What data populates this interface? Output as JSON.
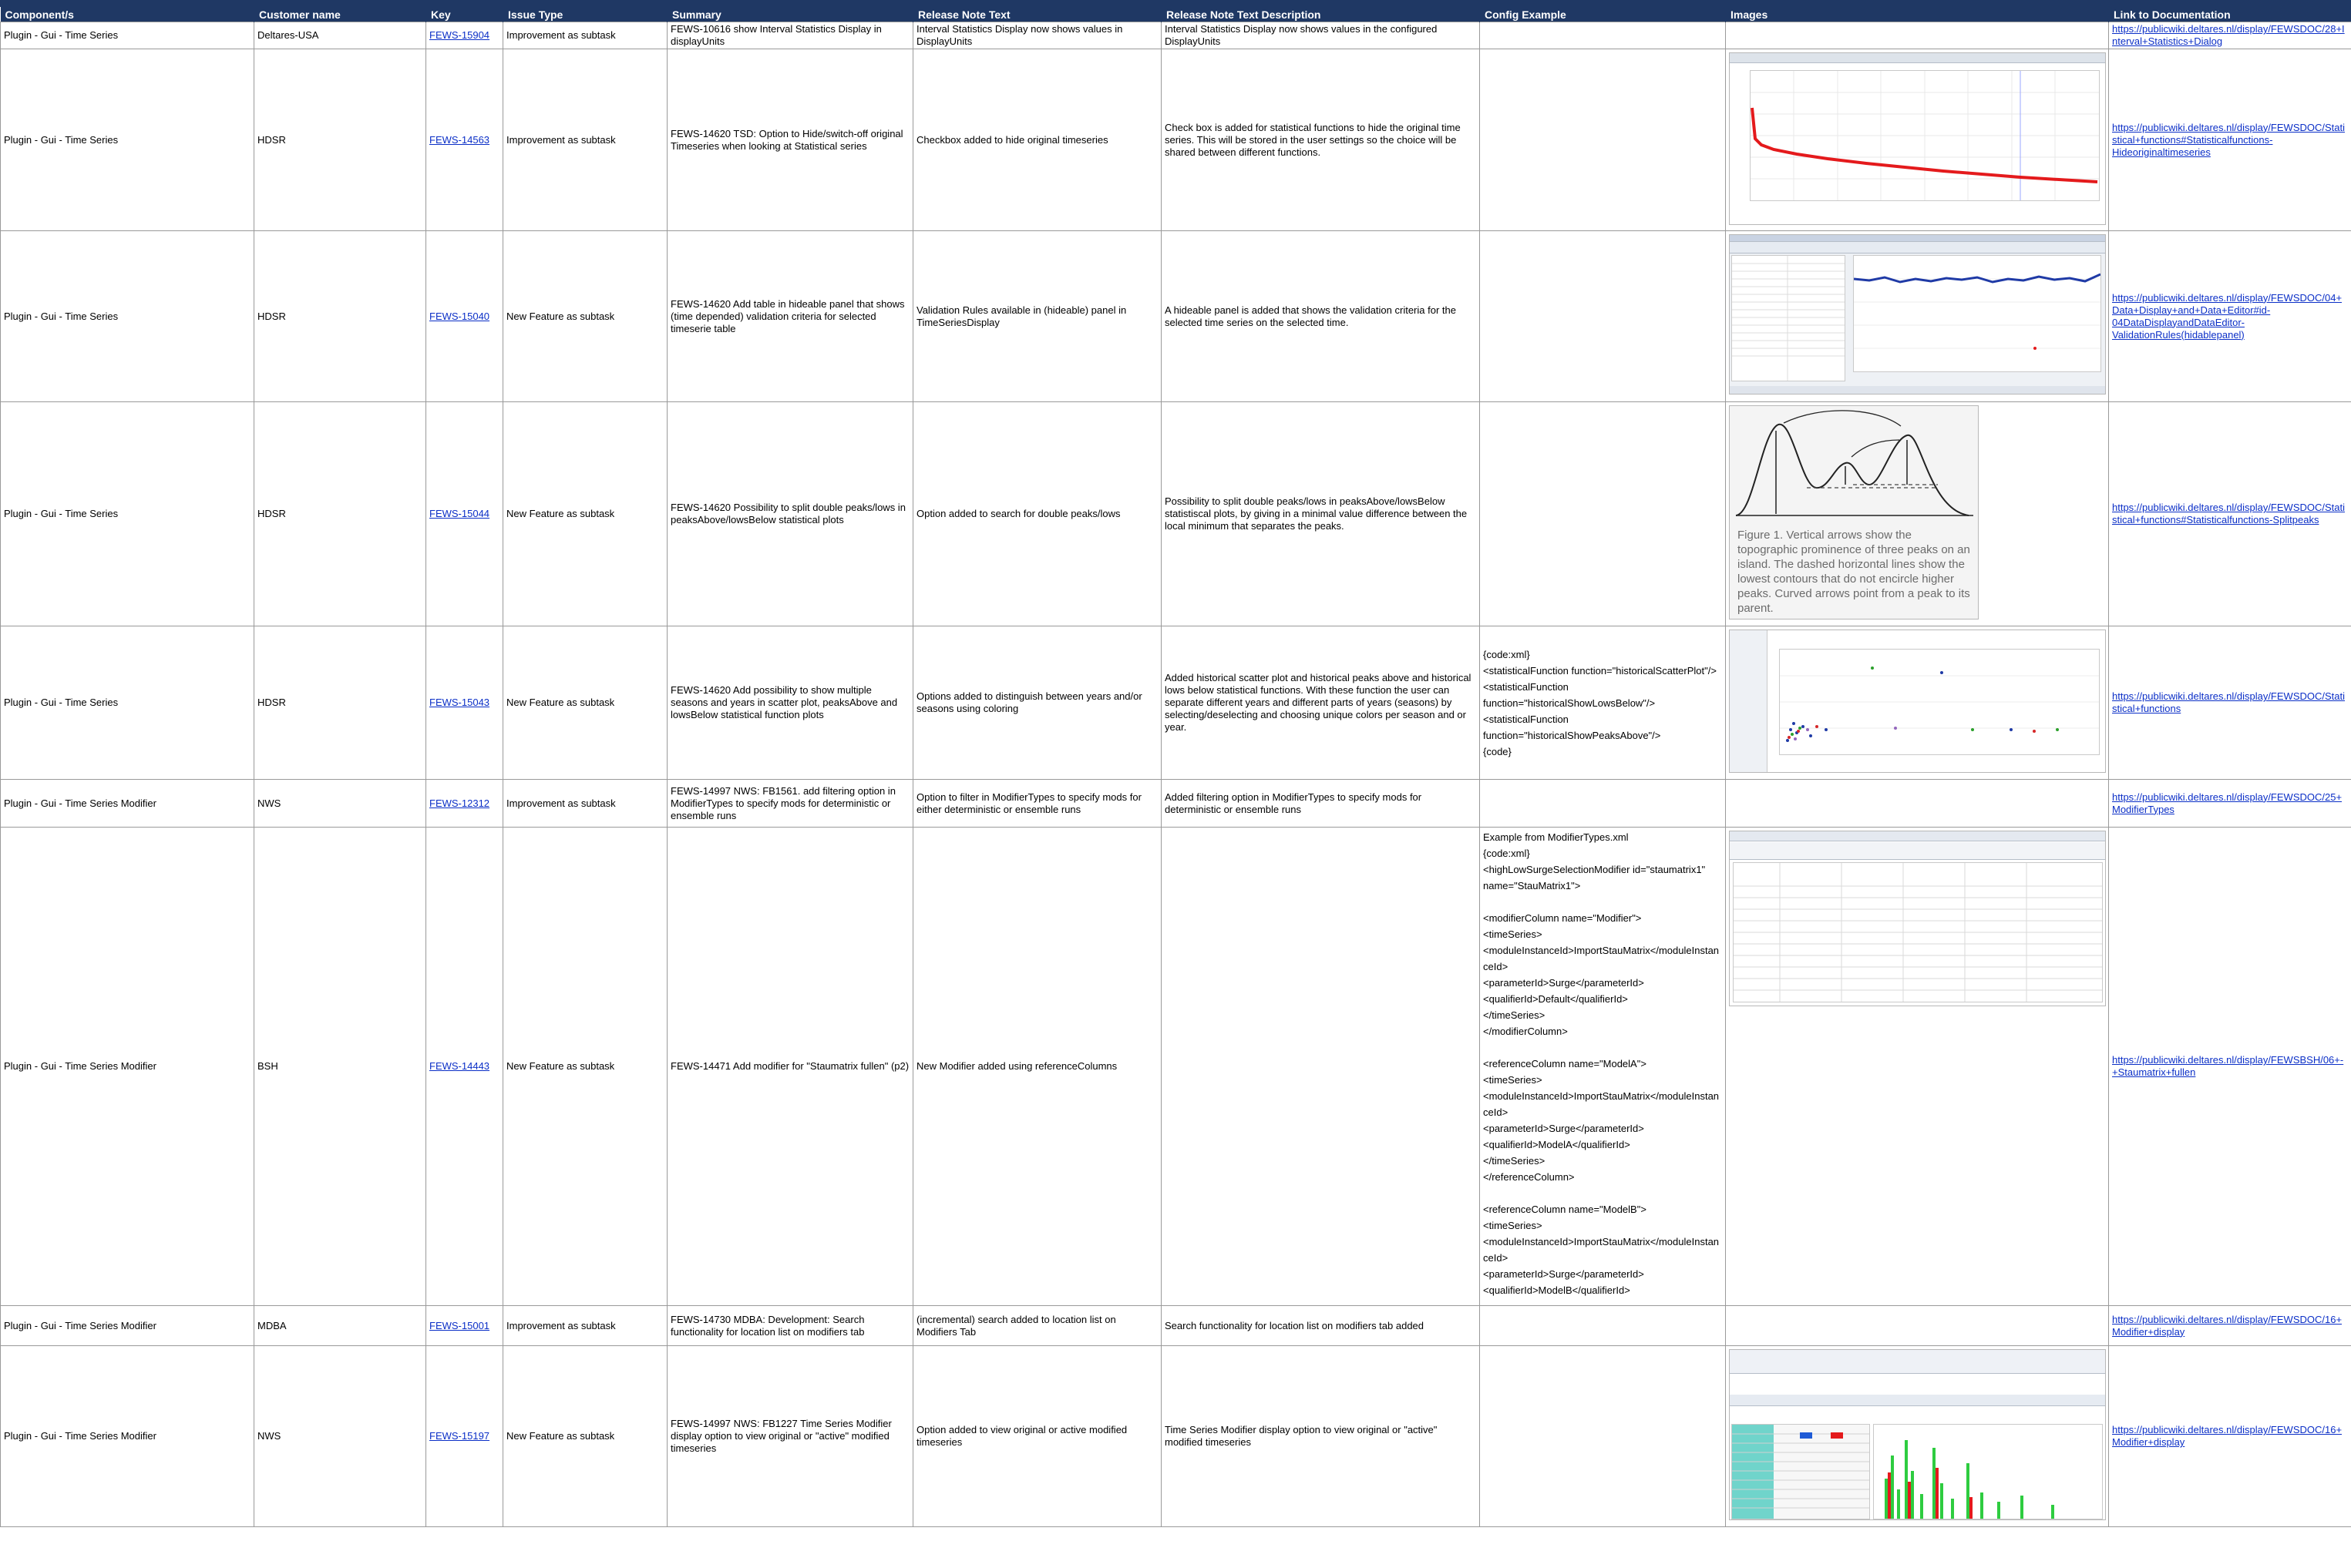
{
  "headers": {
    "component": "Component/s",
    "customer": "Customer name",
    "key": "Key",
    "issue_type": "Issue Type",
    "summary": "Summary",
    "release_note": "Release Note Text",
    "release_desc": "Release Note Text Description",
    "config": "Config Example",
    "images": "Images",
    "link": "Link to Documentation"
  },
  "rows": [
    {
      "component": "Plugin - Gui - Time Series",
      "customer": "Deltares-USA",
      "key": "FEWS-15904",
      "issue_type": "Improvement as subtask",
      "summary": "FEWS-10616 show Interval Statistics Display in displayUnits",
      "release_note": "Interval Statistics Display now shows values in DisplayUnits",
      "release_desc": "Interval Statistics Display now shows values in the configured DisplayUnits",
      "config": "",
      "link": "https://publicwiki.deltares.nl/display/FEWSDOC/28+Interval+Statistics+Dialog"
    },
    {
      "component": "Plugin - Gui - Time Series",
      "customer": "HDSR",
      "key": "FEWS-14563",
      "issue_type": "Improvement as subtask",
      "summary": "FEWS-14620 TSD: Option to Hide/switch-off original Timeseries when looking at Statistical series",
      "release_note": "Checkbox added to hide original timeseries",
      "release_desc": "Check box is added for statistical functions to hide the original time series. This will be stored in the user settings so the choice will be shared between different functions.",
      "config": "",
      "link": "https://publicwiki.deltares.nl/display/FEWSDOC/Statistical+functions#Statisticalfunctions-Hideoriginaltimeseries"
    },
    {
      "component": "Plugin - Gui - Time Series",
      "customer": "HDSR",
      "key": "FEWS-15040",
      "issue_type": "New Feature as subtask",
      "summary": "FEWS-14620 Add table in hideable panel that shows (time depended) validation criteria for selected timeserie table",
      "release_note": "Validation Rules available in (hideable) panel in TimeSeriesDisplay",
      "release_desc": "A hideable panel is added that shows the validation criteria for the selected time series on the selected time.",
      "config": "",
      "link": "https://publicwiki.deltares.nl/display/FEWSDOC/04+Data+Display+and+Data+Editor#id-04DataDisplayandDataEditor-ValidationRules(hidablepanel)"
    },
    {
      "component": "Plugin - Gui - Time Series",
      "customer": "HDSR",
      "key": "FEWS-15044",
      "issue_type": "New Feature as subtask",
      "summary": "FEWS-14620 Possibility to split double peaks/lows in peaksAbove/lowsBelow statistical plots",
      "release_note": "Option added to search for double peaks/lows",
      "release_desc": "Possibility to split double peaks/lows in peaksAbove/lowsBelow statistiscal plots, by giving in a minimal value difference between the local minimum that separates the peaks.",
      "config": "",
      "image_caption": "Figure 1. Vertical arrows show the topographic prominence of three peaks on an island. The dashed horizontal lines show the lowest contours that do not encircle higher peaks. Curved arrows point from a peak to its parent.",
      "link": "https://publicwiki.deltares.nl/display/FEWSDOC/Statistical+functions#Statisticalfunctions-Splitpeaks"
    },
    {
      "component": "Plugin - Gui - Time Series",
      "customer": "HDSR",
      "key": "FEWS-15043",
      "issue_type": "New Feature as subtask",
      "summary": "FEWS-14620 Add possibility to show multiple seasons and years in scatter plot, peaksAbove and lowsBelow statistical function plots",
      "release_note": "Options added to distinguish between years and/or seasons using coloring",
      "release_desc": "Added historical scatter plot and historical peaks above and historical lows below statistical functions. With these function the user can separate different years and different parts of years (seasons) by selecting/deselecting and choosing unique colors per season and or year.",
      "config": "{code:xml}\n<statisticalFunction function=\"historicalScatterPlot\"/>\n<statisticalFunction function=\"historicalShowLowsBelow\"/>\n<statisticalFunction function=\"historicalShowPeaksAbove\"/>\n{code}",
      "link": "https://publicwiki.deltares.nl/display/FEWSDOC/Statistical+functions"
    },
    {
      "component": "Plugin - Gui - Time Series Modifier",
      "customer": "NWS",
      "key": "FEWS-12312",
      "issue_type": "Improvement as subtask",
      "summary": "FEWS-14997 NWS: FB1561. add filtering option in ModifierTypes to specify mods for deterministic or ensemble runs",
      "release_note": "Option to filter in ModifierTypes to specify mods for either deterministic or ensemble runs",
      "release_desc": "Added filtering option in ModifierTypes to specify mods for deterministic or ensemble runs",
      "config": "",
      "link": "https://publicwiki.deltares.nl/display/FEWSDOC/25+ModifierTypes"
    },
    {
      "component": "Plugin - Gui - Time Series Modifier",
      "customer": "BSH",
      "key": "FEWS-14443",
      "issue_type": "New Feature as subtask",
      "summary": "FEWS-14471 Add modifier for \"Staumatrix fullen\" (p2)",
      "release_note": "New Modifier added using referenceColumns",
      "release_desc": "",
      "config": "Example from ModifierTypes.xml\n{code:xml}\n<highLowSurgeSelectionModifier id=\"staumatrix1\" name=\"StauMatrix1\">\n\n<modifierColumn name=\"Modifier\">\n<timeSeries>\n<moduleInstanceId>ImportStauMatrix</moduleInstanceId>\n<parameterId>Surge</parameterId>\n<qualifierId>Default</qualifierId>\n</timeSeries>\n</modifierColumn>\n\n<referenceColumn name=\"ModelA\">\n<timeSeries>\n<moduleInstanceId>ImportStauMatrix</moduleInstanceId>\n<parameterId>Surge</parameterId>\n<qualifierId>ModelA</qualifierId>\n</timeSeries>\n</referenceColumn>\n\n<referenceColumn name=\"ModelB\">\n<timeSeries>\n<moduleInstanceId>ImportStauMatrix</moduleInstanceId>\n<parameterId>Surge</parameterId>\n<qualifierId>ModelB</qualifierId>\n</timeSeries>\n</referenceColumn>",
      "link": "https://publicwiki.deltares.nl/display/FEWSBSH/06+-+Staumatrix+fullen"
    },
    {
      "component": "Plugin - Gui - Time Series Modifier",
      "customer": "MDBA",
      "key": "FEWS-15001",
      "issue_type": "Improvement as subtask",
      "summary": "FEWS-14730 MDBA: Development: Search functionality for location list on modifiers tab",
      "release_note": "(incremental) search added to location list on Modifiers Tab",
      "release_desc": "Search functionality for location list on modifiers tab added",
      "config": "",
      "link": "https://publicwiki.deltares.nl/display/FEWSDOC/16+Modifier+display"
    },
    {
      "component": "Plugin - Gui - Time Series Modifier",
      "customer": "NWS",
      "key": "FEWS-15197",
      "issue_type": "New Feature as subtask",
      "summary": "FEWS-14997 NWS: FB1227 Time Series Modifier display option to view original or \"active\" modified timeseries",
      "release_note": "Option added to view original or active modified timeseries",
      "release_desc": "Time Series Modifier display option to view original or \"active\" modified timeseries",
      "config": "",
      "link": "https://publicwiki.deltares.nl/display/FEWSDOC/16+Modifier+display"
    }
  ]
}
